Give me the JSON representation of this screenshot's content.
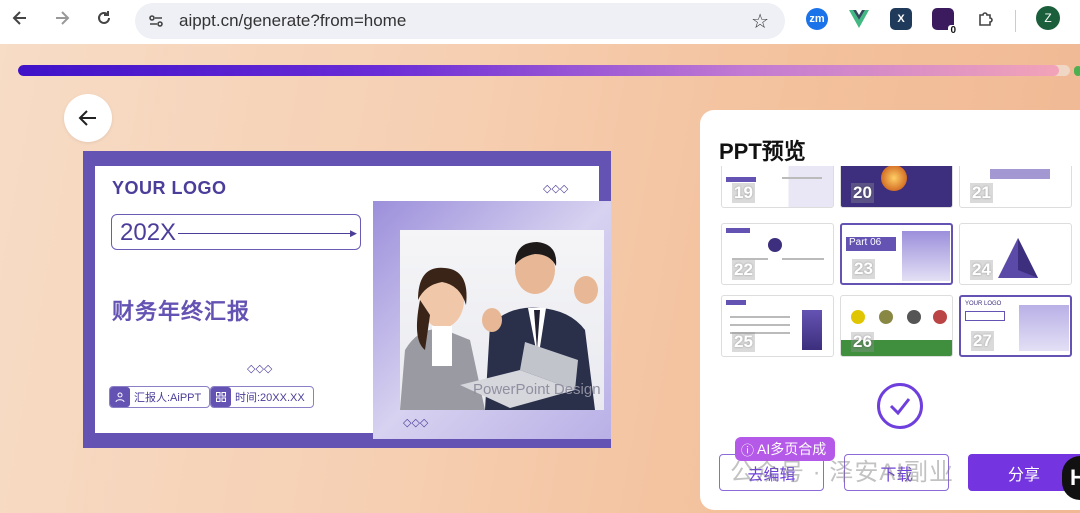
{
  "browser": {
    "url": "aippt.cn/generate?from=home",
    "extensions": [
      {
        "name": "zm-icon",
        "label": "zm",
        "color": "#1a73e8"
      },
      {
        "name": "vue-icon",
        "label": "▼",
        "color": "#42b883"
      },
      {
        "name": "x-icon",
        "label": "X",
        "color": "#1f3a5a"
      },
      {
        "name": "notebook-icon",
        "label": "",
        "color": "#3b1a5e"
      },
      {
        "name": "extensions-puzzle-icon",
        "label": "",
        "color": "#555555"
      }
    ],
    "notebook_badge": "0",
    "avatar_letter": "Z"
  },
  "progress": {
    "percent": 99
  },
  "slide": {
    "logo": "YOUR LOGO",
    "year": "202X",
    "title": "财务年终汇报",
    "reporter": "汇报人:AiPPT",
    "time": "时间:20XX.XX",
    "design_text": "PowerPoint Design"
  },
  "panel": {
    "title": "PPT预览",
    "thumbnails": [
      "19",
      "20",
      "21",
      "22",
      "23",
      "24",
      "25",
      "26",
      "27"
    ],
    "thumb_23_label": "Part 06",
    "thumb_27_label": "YOUR LOGO"
  },
  "badge": "AI多页合成",
  "buttons": {
    "edit": "去编辑",
    "download": "下载",
    "share": "分享"
  },
  "watermark": "公众号 · 泽安AI副业",
  "colors": {
    "accent": "#7434e0",
    "slide_purple": "#6553b3"
  }
}
